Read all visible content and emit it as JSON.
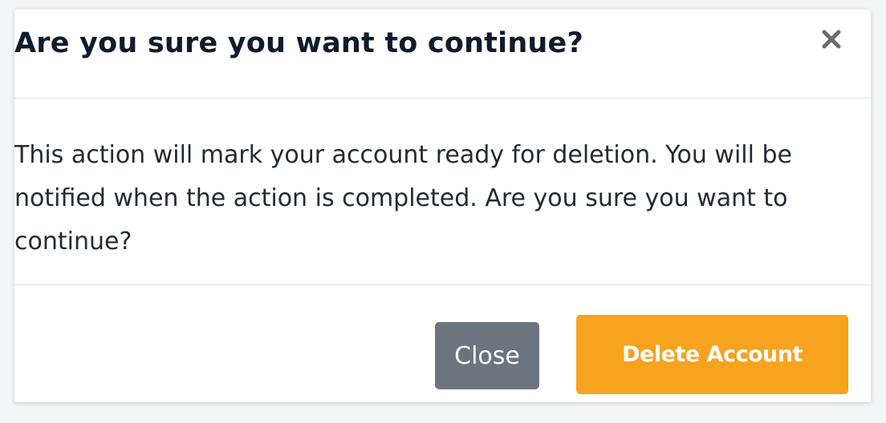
{
  "dialog": {
    "title": "Are you sure you want to continue?",
    "message": "This action will mark your account ready for deletion. You will be notified when the action is completed. Are you sure you want to continue?",
    "close_icon": "close-icon",
    "buttons": {
      "close_label": "Close",
      "delete_label": "Delete Account"
    }
  },
  "colors": {
    "title_text": "#0f1b2d",
    "body_text": "#222a33",
    "close_button": "#6c757d",
    "delete_button": "#f7a31f",
    "divider": "#dee2e6",
    "close_icon": "#6b6b6b"
  }
}
